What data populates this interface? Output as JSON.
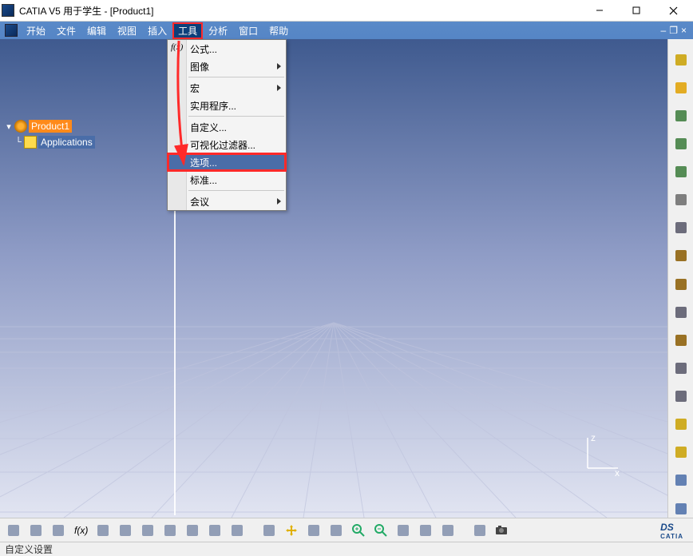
{
  "title": "CATIA V5 用于学生 - [Product1]",
  "menubar": {
    "items": [
      "开始",
      "文件",
      "编辑",
      "视图",
      "插入",
      "工具",
      "分析",
      "窗口",
      "帮助"
    ],
    "active_index": 5,
    "mdi_min": "–",
    "mdi_restore": "❐",
    "mdi_close": "×"
  },
  "dropdown": {
    "items": [
      {
        "label": "公式...",
        "icon": "f(x)",
        "submenu": false
      },
      {
        "label": "图像",
        "submenu": true
      },
      {
        "sep": true
      },
      {
        "label": "宏",
        "submenu": true
      },
      {
        "label": "实用程序...",
        "submenu": false
      },
      {
        "sep": true
      },
      {
        "label": "自定义...",
        "submenu": false
      },
      {
        "label": "可视化过滤器...",
        "submenu": false
      },
      {
        "label": "选项...",
        "submenu": false,
        "selected": true,
        "highlighted": true
      },
      {
        "label": "标准...",
        "submenu": false
      },
      {
        "sep": true
      },
      {
        "label": "会议",
        "submenu": true
      }
    ]
  },
  "tree": {
    "product": "Product1",
    "applications": "Applications"
  },
  "axis": {
    "z": "z",
    "x": "x"
  },
  "statusbar": {
    "text": "自定义设置"
  },
  "right_icons": [
    "bulb-icon",
    "cursor-icon",
    "gear-a-icon",
    "gear-b-icon",
    "gear-c-icon",
    "stack-icon",
    "layers-icon",
    "ruler-a-icon",
    "box-icon",
    "grid-icon",
    "ruler-b-icon",
    "list-a-icon",
    "list-b-icon",
    "star-icon",
    "bulb2-icon",
    "axes-icon",
    "nav-icon"
  ],
  "bottom_icons": [
    "rect",
    "ruler",
    "up",
    "fx",
    "palette",
    "tulip",
    "tool",
    "grid",
    "boxdot",
    "box",
    "cube",
    "sep",
    "pointer",
    "move",
    "rotate",
    "hand",
    "zoomin",
    "zoomout",
    "pan",
    "iso",
    "fly",
    "sep",
    "align",
    "camera"
  ],
  "ds_logo": "DS",
  "ds_sub": "CATIA"
}
